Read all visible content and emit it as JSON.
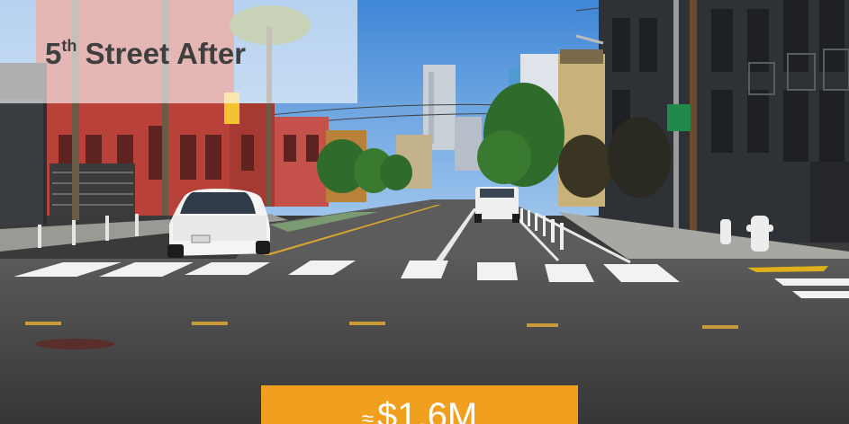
{
  "title": {
    "number": "5",
    "ordinal": "th",
    "rest": " Street After"
  },
  "cost": {
    "prefix": "≈",
    "value": "$1.6M"
  },
  "colors": {
    "sky": "#4a8fd8",
    "asphalt": "#3d3d3d",
    "brick": "#b8423a",
    "building_dark": "#2e3136",
    "tree": "#2f6b2a",
    "cost_box": "#f0a01e"
  }
}
